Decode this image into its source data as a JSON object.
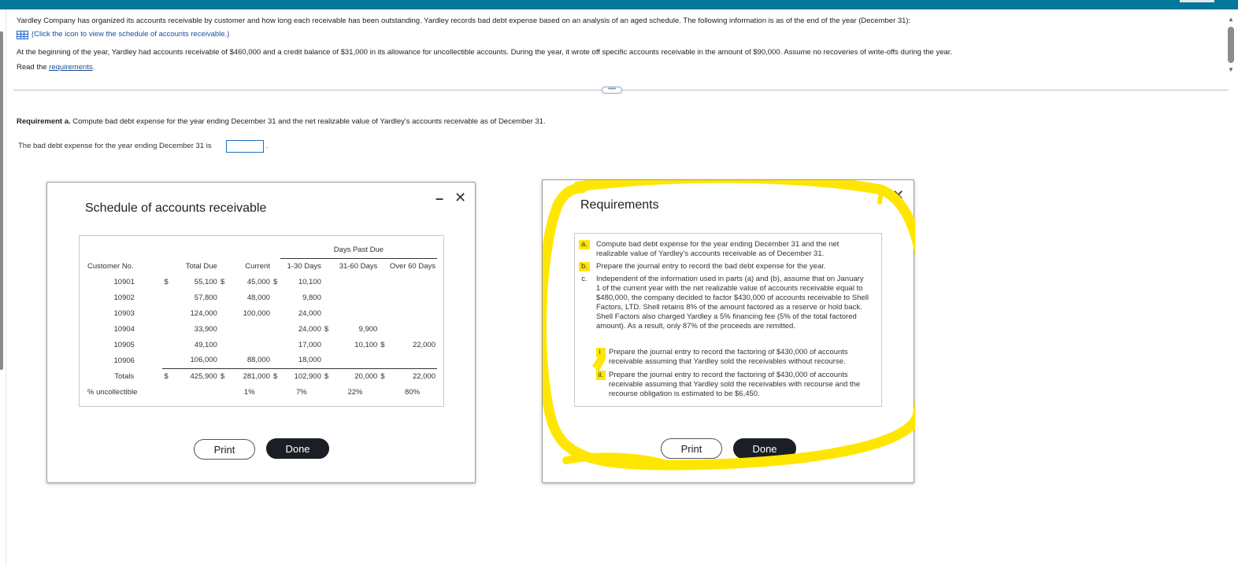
{
  "intro": {
    "text": "Yardley Company has organized its accounts receivable by customer and how long each receivable has been outstanding. Yardley records bad debt expense based on an analysis of an aged schedule. The following information is as of the end of the year (December 31):",
    "icon_link": "(Click the icon to view the schedule of accounts receivable.)",
    "icon": "table-grid-icon",
    "beginning": "At the beginning of the year, Yardley had accounts receivable of $460,000 and a credit balance of $31,000 in its allowance for uncollectible accounts. During the year, it wrote off specific accounts receivable in the amount of $90,000. Assume no recoveries of write-offs during the year.",
    "read_prefix": "Read the ",
    "read_link": "requirements",
    "read_suffix": "."
  },
  "more_handle": "••••",
  "requirement_a": {
    "label": "Requirement a.",
    "text": "Compute bad debt expense for the year ending December 31 and the net realizable value of Yardley's accounts receivable as of December 31.",
    "prompt": "The bad debt expense for the year ending December 31 is",
    "answer_value": "",
    "suffix": "."
  },
  "schedule_dialog": {
    "title": "Schedule of accounts receivable",
    "minimize": "–",
    "close": "✕",
    "group_header": "Days Past Due",
    "headers": [
      "Customer No.",
      "Total Due",
      "Current",
      "1-30 Days",
      "31-60 Days",
      "Over 60 Days"
    ],
    "rows": [
      [
        "10901",
        "$",
        "55,100",
        "$",
        "45,000",
        "$",
        "10,100",
        "",
        "",
        "",
        ""
      ],
      [
        "10902",
        "",
        "57,800",
        "",
        "48,000",
        "",
        "9,800",
        "",
        "",
        "",
        ""
      ],
      [
        "10903",
        "",
        "124,000",
        "",
        "100,000",
        "",
        "24,000",
        "",
        "",
        "",
        ""
      ],
      [
        "10904",
        "",
        "33,900",
        "",
        "",
        "",
        "24,000",
        "$",
        "9,900",
        "",
        ""
      ],
      [
        "10905",
        "",
        "49,100",
        "",
        "",
        "",
        "17,000",
        "",
        "10,100",
        "$",
        "22,000"
      ],
      [
        "10906",
        "",
        "106,000",
        "",
        "88,000",
        "",
        "18,000",
        "",
        "",
        "",
        ""
      ]
    ],
    "totals": [
      "Totals",
      "$",
      "425,900",
      "$",
      "281,000",
      "$",
      "102,900",
      "$",
      "20,000",
      "$",
      "22,000"
    ],
    "uncollectible": [
      "% uncollectible",
      "",
      "",
      "",
      "1%",
      "",
      "7%",
      "",
      "22%",
      "",
      "80%"
    ],
    "print": "Print",
    "done": "Done"
  },
  "requirements_dialog": {
    "title": "Requirements",
    "close": "✕",
    "items": [
      {
        "letter": "a.",
        "text": "Compute bad debt expense for the year ending December 31 and the net realizable value of Yardley's accounts receivable as of December 31."
      },
      {
        "letter": "b.",
        "text": "Prepare the journal entry to record the bad debt expense for the year."
      },
      {
        "letter": "c.",
        "text": "Independent of the information used in parts (a) and (b), assume that on January 1 of the current year with the net realizable value of accounts receivable equal to $480,000, the company decided to factor $430,000 of accounts receivable to Shell Factors, LTD. Shell retains 8% of the amount factored as a reserve or hold back. Shell Factors also charged Yardley a 5% financing fee (5% of the total factored amount). As a result, only 87% of the proceeds are remitted."
      }
    ],
    "subitems": [
      {
        "letter": "i.",
        "text": "Prepare the journal entry to record the factoring of $430,000 of accounts receivable assuming that Yardley sold the receivables without recourse."
      },
      {
        "letter": "ii.",
        "text": "Prepare the journal entry to record the factoring of $430,000 of accounts receivable assuming that Yardley sold the receivables with recourse and the recourse obligation is estimated to be $6,450."
      }
    ],
    "print": "Print",
    "done": "Done",
    "highlight_color": "#ffe600"
  },
  "colors": {
    "topbar": "#00779b",
    "link": "#1a4f9c",
    "done_button": "#1b1e24",
    "highlight": "#ffe600"
  }
}
